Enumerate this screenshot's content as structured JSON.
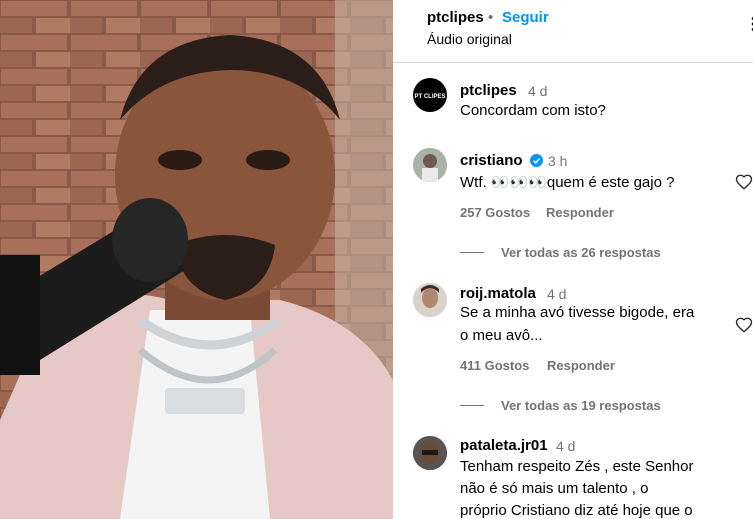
{
  "header": {
    "username": "ptclipes",
    "separator": "•",
    "follow_label": "Seguir",
    "audio_label": "Áudio original",
    "more_icon": "more-icon"
  },
  "media": {
    "description_icon": "video-frame"
  },
  "caption": {
    "username": "ptclipes",
    "time": "4 d",
    "text": "Concordam com isto?",
    "avatar_text": "PT CLIPES"
  },
  "comments": [
    {
      "username": "cristiano",
      "verified": true,
      "time": "3 h",
      "text": "Wtf. 👀👀👀quem é este gajo ?",
      "likes": "257 Gostos",
      "reply": "Responder",
      "view_replies": "Ver todas as 26 respostas"
    },
    {
      "username": "roij.matola",
      "verified": false,
      "time": "4 d",
      "text_lines": [
        "Se a minha avó tivesse bigode, era",
        "o meu avô..."
      ],
      "likes": "411 Gostos",
      "reply": "Responder",
      "view_replies": "Ver todas as 19 respostas"
    },
    {
      "username": "pataleta.jr01",
      "verified": false,
      "time": "4 d",
      "text_lines": [
        "Tenham respeito Zés , este Senhor",
        "não é só mais um talento , o",
        "próprio Cristiano diz até hoje que o"
      ]
    }
  ],
  "colors": {
    "accent": "#0095f6",
    "muted": "#737373",
    "verified": "#0095f6"
  }
}
